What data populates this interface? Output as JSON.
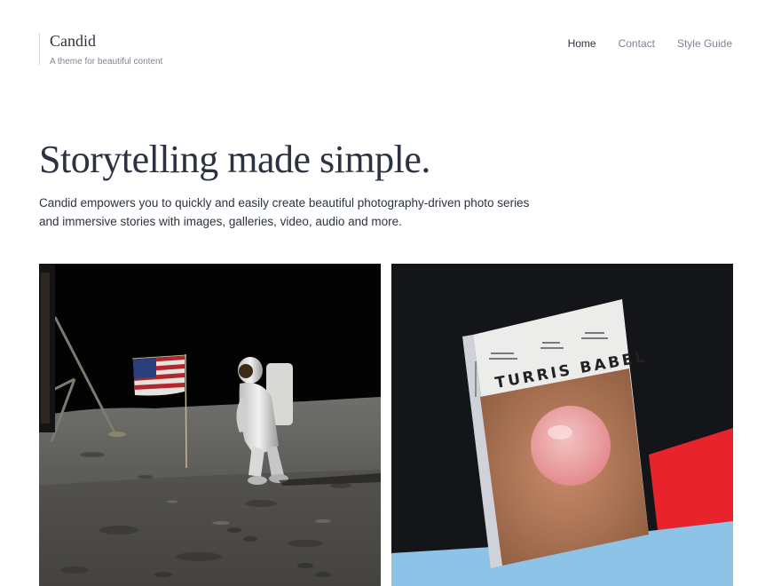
{
  "site": {
    "title": "Candid",
    "tagline": "A theme for beautiful content"
  },
  "nav": {
    "items": [
      {
        "label": "Home",
        "active": true
      },
      {
        "label": "Contact",
        "active": false
      },
      {
        "label": "Style Guide",
        "active": false
      }
    ]
  },
  "hero": {
    "title": "Storytelling made simple.",
    "intro": "Candid empowers you to quickly and easily create beautiful photography-driven photo series and immersive stories with images, galleries, video, audio and more."
  },
  "gallery": {
    "photos": [
      {
        "subject": "astronaut-moon-flag-photo"
      },
      {
        "subject": "turris-babel-magazine-photo",
        "magazine_title": "TURRIS BABEL"
      }
    ]
  },
  "colors": {
    "text": "#2b3340",
    "muted": "#7c8696",
    "background": "#ffffff"
  }
}
